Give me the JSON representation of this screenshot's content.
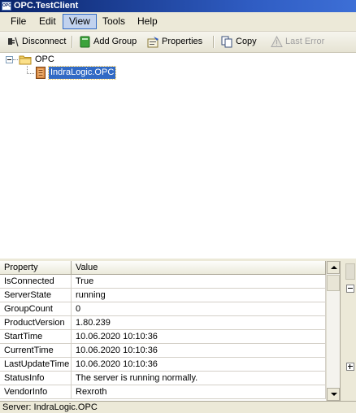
{
  "window": {
    "title": "OPC.TestClient",
    "app_icon_text": "OPC"
  },
  "menu": [
    "File",
    "Edit",
    "View",
    "Tools",
    "Help"
  ],
  "menu_active": "View",
  "toolbar": {
    "disconnect": "Disconnect",
    "add_group": "Add Group",
    "properties": "Properties",
    "copy": "Copy",
    "last_error": "Last Error"
  },
  "tree": {
    "root": "OPC",
    "child": "IndraLogic.OPC"
  },
  "grid": {
    "headers": {
      "property": "Property",
      "value": "Value"
    },
    "rows": [
      {
        "property": "IsConnected",
        "value": "True"
      },
      {
        "property": "ServerState",
        "value": "running"
      },
      {
        "property": "GroupCount",
        "value": "0"
      },
      {
        "property": "ProductVersion",
        "value": "1.80.239"
      },
      {
        "property": "StartTime",
        "value": "10.06.2020 10:10:36"
      },
      {
        "property": "CurrentTime",
        "value": "10.06.2020 10:10:36"
      },
      {
        "property": "LastUpdateTime",
        "value": "10.06.2020 10:10:36"
      },
      {
        "property": "StatusInfo",
        "value": "The server is running normally."
      },
      {
        "property": "VendorInfo",
        "value": "Rexroth"
      }
    ]
  },
  "status": {
    "text": "Server: IndraLogic.OPC"
  },
  "colors": {
    "titlebar": "#0a246a",
    "selection": "#316ac5",
    "chrome": "#ece9d8"
  }
}
